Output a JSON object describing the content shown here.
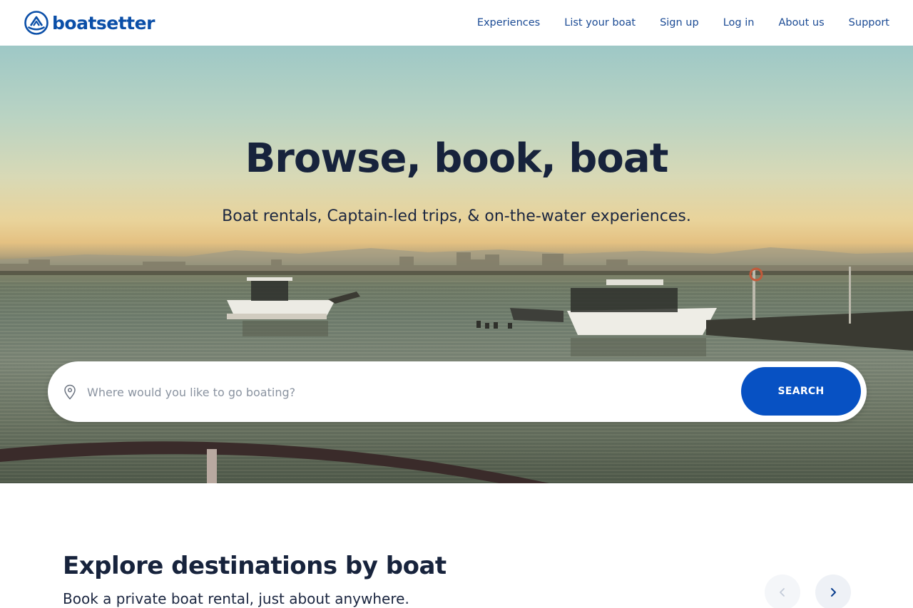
{
  "header": {
    "logo_text": "boatsetter",
    "nav": [
      {
        "label": "Experiences"
      },
      {
        "label": "List your boat"
      },
      {
        "label": "Sign up"
      },
      {
        "label": "Log in"
      },
      {
        "label": "About us"
      },
      {
        "label": "Support"
      }
    ]
  },
  "hero": {
    "title": "Browse, book, boat",
    "subtitle": "Boat rentals, Captain-led trips, & on-the-water experiences."
  },
  "search": {
    "placeholder": "Where would you like to go boating?",
    "value": "",
    "button_label": "SEARCH",
    "icon": "map-pin-icon"
  },
  "explore": {
    "title": "Explore destinations by boat",
    "subtitle": "Book a private boat rental, just about anywhere.",
    "prev_icon": "chevron-left-icon",
    "next_icon": "chevron-right-icon"
  },
  "colors": {
    "brand": "#0b4fa8",
    "button": "#0751c3",
    "heading": "#17233c"
  }
}
